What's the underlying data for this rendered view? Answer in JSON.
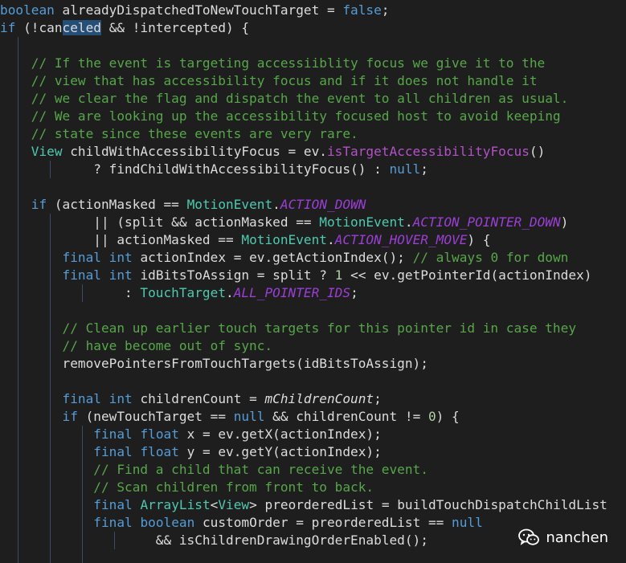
{
  "colors": {
    "background": "#1e1e1e",
    "keyword": "#569cd6",
    "type": "#4ec9b0",
    "comment": "#57a64a",
    "number": "#b5cea8",
    "constant_field": "#9b3fd6",
    "method_highlight": "#b451c8",
    "plain": "#dcdcdc",
    "selection": "#264f78",
    "indent_guide": "#3e4a63"
  },
  "editor": {
    "lines": [
      [
        [
          "kw",
          "boolean"
        ],
        [
          "id",
          " alreadyDispatchedToNewTouchTarget = "
        ],
        [
          "kw",
          "false"
        ],
        [
          "id",
          ";"
        ]
      ],
      [
        [
          "kw",
          "if"
        ],
        [
          "id",
          " (!"
        ],
        [
          "id",
          "can"
        ],
        [
          "sel",
          "celed"
        ],
        [
          "id",
          " && !intercepted) {"
        ]
      ],
      [],
      [
        [
          "cm",
          "    // If the event is targeting accessiiblity focus we give it to the"
        ]
      ],
      [
        [
          "cm",
          "    // view that has accessibility focus and if it does not handle it"
        ]
      ],
      [
        [
          "cm",
          "    // we clear the flag and dispatch the event to all children as usual."
        ]
      ],
      [
        [
          "cm",
          "    // We are looking up the accessibility focused host to avoid keeping"
        ]
      ],
      [
        [
          "cm",
          "    // state since these events are very rare."
        ]
      ],
      [
        [
          "id",
          "    "
        ],
        [
          "cls",
          "View"
        ],
        [
          "id",
          " childWithAccessibilityFocus = ev."
        ],
        [
          "mth",
          "isTargetAccessibilityFocus"
        ],
        [
          "id",
          "()"
        ]
      ],
      [
        [
          "id",
          "            ? findChildWithAccessibilityFocus() : "
        ],
        [
          "kw",
          "null"
        ],
        [
          "id",
          ";"
        ]
      ],
      [],
      [
        [
          "id",
          "    "
        ],
        [
          "kw",
          "if"
        ],
        [
          "id",
          " (actionMasked == "
        ],
        [
          "cls",
          "MotionEvent"
        ],
        [
          "id",
          "."
        ],
        [
          "fld",
          "ACTION_DOWN"
        ]
      ],
      [
        [
          "id",
          "            || (split && actionMasked == "
        ],
        [
          "cls",
          "MotionEvent"
        ],
        [
          "id",
          "."
        ],
        [
          "fld",
          "ACTION_POINTER_DOWN"
        ],
        [
          "id",
          ")"
        ]
      ],
      [
        [
          "id",
          "            || actionMasked == "
        ],
        [
          "cls",
          "MotionEvent"
        ],
        [
          "id",
          "."
        ],
        [
          "fld",
          "ACTION_HOVER_MOVE"
        ],
        [
          "id",
          ") {"
        ]
      ],
      [
        [
          "id",
          "        "
        ],
        [
          "kw",
          "final"
        ],
        [
          "id",
          " "
        ],
        [
          "kw",
          "int"
        ],
        [
          "id",
          " actionIndex = ev.getActionIndex(); "
        ],
        [
          "cm",
          "// always 0 for down"
        ]
      ],
      [
        [
          "id",
          "        "
        ],
        [
          "kw",
          "final"
        ],
        [
          "id",
          " "
        ],
        [
          "kw",
          "int"
        ],
        [
          "id",
          " idBitsToAssign = split ? "
        ],
        [
          "num",
          "1"
        ],
        [
          "id",
          " << ev.getPointerId(actionIndex)"
        ]
      ],
      [
        [
          "id",
          "                : "
        ],
        [
          "cls",
          "TouchTarget"
        ],
        [
          "id",
          "."
        ],
        [
          "fld",
          "ALL_POINTER_IDS"
        ],
        [
          "id",
          ";"
        ]
      ],
      [],
      [
        [
          "cm",
          "        // Clean up earlier touch targets for this pointer id in case they"
        ]
      ],
      [
        [
          "cm",
          "        // have become out of sync."
        ]
      ],
      [
        [
          "id",
          "        removePointersFromTouchTargets(idBitsToAssign);"
        ]
      ],
      [],
      [
        [
          "id",
          "        "
        ],
        [
          "kw",
          "final"
        ],
        [
          "id",
          " "
        ],
        [
          "kw",
          "int"
        ],
        [
          "id",
          " childrenCount = "
        ],
        [
          "field",
          "mChildrenCount"
        ],
        [
          "id",
          ";"
        ]
      ],
      [
        [
          "id",
          "        "
        ],
        [
          "kw",
          "if"
        ],
        [
          "id",
          " (newTouchTarget == "
        ],
        [
          "kw",
          "null"
        ],
        [
          "id",
          " && childrenCount != "
        ],
        [
          "num",
          "0"
        ],
        [
          "id",
          ") {"
        ]
      ],
      [
        [
          "id",
          "            "
        ],
        [
          "kw",
          "final"
        ],
        [
          "id",
          " "
        ],
        [
          "kw",
          "float"
        ],
        [
          "id",
          " x = ev.getX(actionIndex);"
        ]
      ],
      [
        [
          "id",
          "            "
        ],
        [
          "kw",
          "final"
        ],
        [
          "id",
          " "
        ],
        [
          "kw",
          "float"
        ],
        [
          "id",
          " y = ev.getY(actionIndex);"
        ]
      ],
      [
        [
          "cm",
          "            // Find a child that can receive the event."
        ]
      ],
      [
        [
          "cm",
          "            // Scan children from front to back."
        ]
      ],
      [
        [
          "id",
          "            "
        ],
        [
          "kw",
          "final"
        ],
        [
          "id",
          " "
        ],
        [
          "cls",
          "ArrayList"
        ],
        [
          "id",
          "<"
        ],
        [
          "cls",
          "View"
        ],
        [
          "id",
          "> preorderedList = buildTouchDispatchChildList"
        ]
      ],
      [
        [
          "id",
          "            "
        ],
        [
          "kw",
          "final"
        ],
        [
          "id",
          " "
        ],
        [
          "kw",
          "boolean"
        ],
        [
          "id",
          " customOrder = preorderedList == "
        ],
        [
          "kw",
          "null"
        ]
      ],
      [
        [
          "id",
          "                    && isChildrenDrawingOrderEnabled();"
        ]
      ]
    ]
  },
  "watermark": {
    "text": "nanchen",
    "icon": "wechat-icon"
  }
}
